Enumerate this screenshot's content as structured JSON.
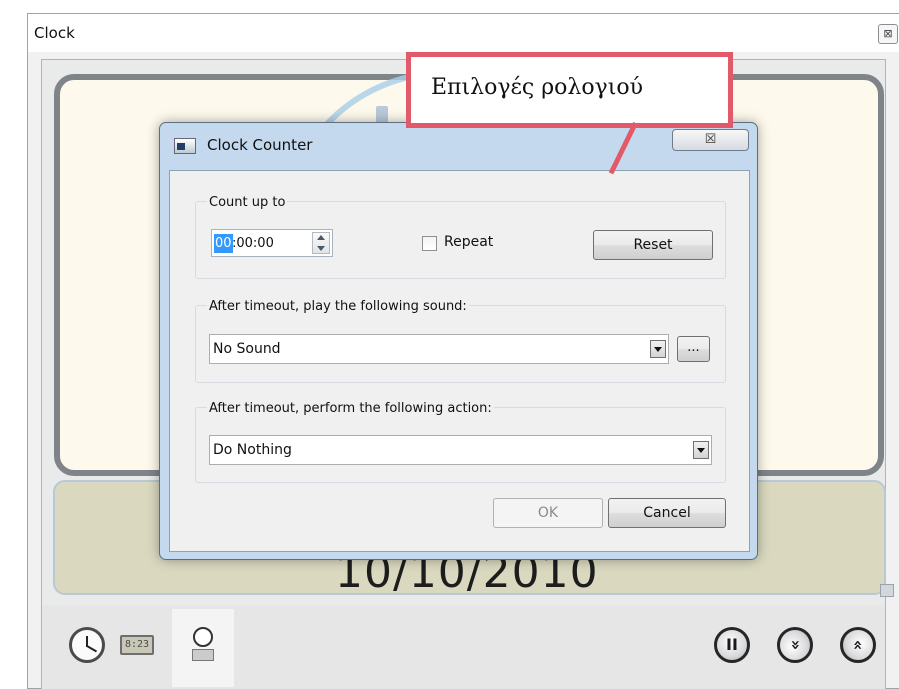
{
  "main_window": {
    "title": "Clock",
    "close_glyph": "⊠"
  },
  "analog_clock": {
    "face_icon": "analog-clock-face"
  },
  "digital_display": {
    "date": "10/10/2010"
  },
  "bottom_toolbar": {
    "digital_icon_text": "8:23",
    "buttons": [
      {
        "name": "pause-button",
        "glyph": "II"
      },
      {
        "name": "collapse-button",
        "glyph": "«"
      },
      {
        "name": "expand-button",
        "glyph": "«"
      }
    ]
  },
  "dialog": {
    "title": "Clock Counter",
    "close_glyph": "☒",
    "count_group": {
      "label": "Count up to",
      "time_hours": "00",
      "time_rest": ":00:00",
      "repeat_label": "Repeat",
      "repeat_checked": false,
      "reset_label": "Reset"
    },
    "sound_group": {
      "label": "After timeout, play the following sound:",
      "selected": "No Sound",
      "browse_label": "..."
    },
    "action_group": {
      "label": "After timeout, perform the following action:",
      "selected": "Do Nothing"
    },
    "ok_label": "OK",
    "cancel_label": "Cancel"
  },
  "callout": {
    "text": "Επιλογές ρολογιού",
    "color": "#e25a6a"
  }
}
